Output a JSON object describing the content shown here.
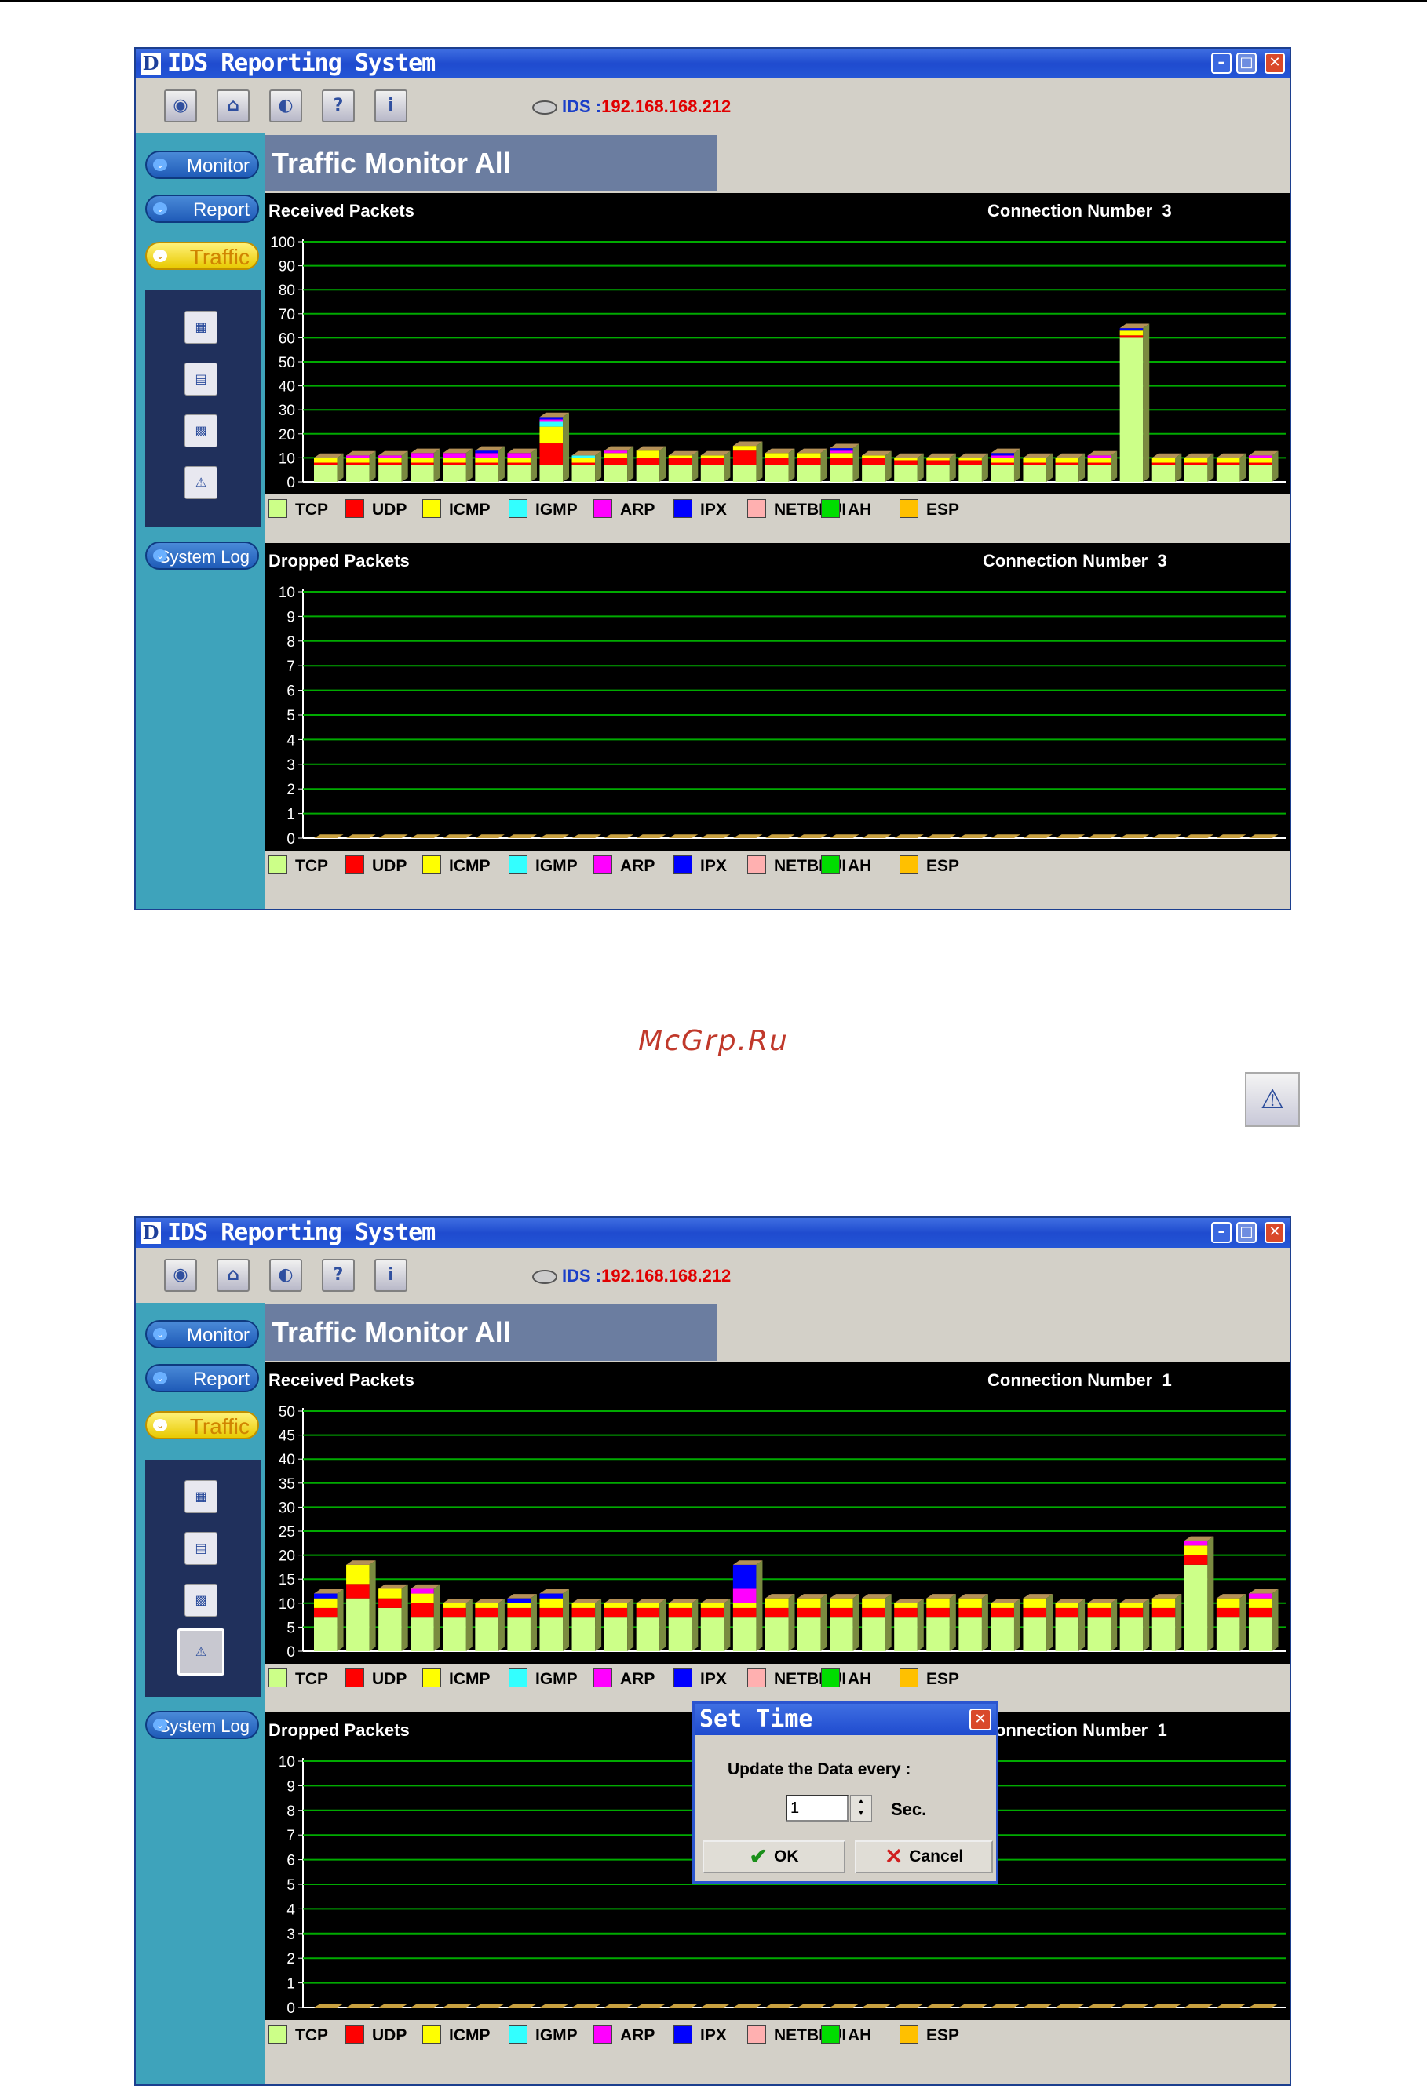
{
  "watermark": "McGrp.Ru",
  "standalone_icon": "traffic-cone-icon",
  "colors": {
    "TCP": "#ccff88",
    "UDP": "#ff0000",
    "ICMP": "#ffff00",
    "IGMP": "#33ffff",
    "ARP": "#ff00ff",
    "IPX": "#0000ff",
    "NETBEUI": "#ffb0b0",
    "AH": "#00dd00",
    "ESP": "#ffc000",
    "grid": "#00aa00"
  },
  "windows": [
    {
      "title": "IDS Reporting System",
      "logo": "D",
      "toolbar_icons": [
        "globe-icon",
        "tower-icon",
        "disk-icon",
        "help-icon",
        "info-icon"
      ],
      "ids_label": "IDS :",
      "ids_ip": "192.168.168.212",
      "nav": {
        "monitor": "Monitor",
        "report": "Report",
        "traffic": "Traffic",
        "system_log": "System Log"
      },
      "subicons": [
        "chart-1-icon",
        "chart-2-icon",
        "chart-3-icon",
        "cone-icon"
      ],
      "selected_subicon": -1,
      "header": "Traffic Monitor  All",
      "received": {
        "title": "Received Packets",
        "connection_label": "Connection Number",
        "connection_value": "3",
        "legend": [
          "TCP",
          "UDP",
          "ICMP",
          "IGMP",
          "ARP",
          "IPX",
          "NETBEUI",
          "AH",
          "ESP"
        ]
      },
      "dropped": {
        "title": "Dropped Packets",
        "connection_label": "Connection Number",
        "connection_value": "3",
        "legend": [
          "TCP",
          "UDP",
          "ICMP",
          "IGMP",
          "ARP",
          "IPX",
          "NETBEUI",
          "AH",
          "ESP"
        ]
      }
    },
    {
      "title": "IDS Reporting System",
      "logo": "D",
      "toolbar_icons": [
        "globe-icon",
        "tower-icon",
        "disk-icon",
        "help-icon",
        "info-icon"
      ],
      "ids_label": "IDS :",
      "ids_ip": "192.168.168.212",
      "nav": {
        "monitor": "Monitor",
        "report": "Report",
        "traffic": "Traffic",
        "system_log": "System Log"
      },
      "subicons": [
        "chart-1-icon",
        "chart-2-icon",
        "chart-3-icon",
        "cone-icon"
      ],
      "selected_subicon": 3,
      "header": "Traffic Monitor  All",
      "received": {
        "title": "Received Packets",
        "connection_label": "Connection Number",
        "connection_value": "1",
        "legend": [
          "TCP",
          "UDP",
          "ICMP",
          "IGMP",
          "ARP",
          "IPX",
          "NETBEUI",
          "AH",
          "ESP"
        ]
      },
      "dropped": {
        "title": "Dropped Packets",
        "connection_label": "Connection Number",
        "connection_value": "1",
        "legend": [
          "TCP",
          "UDP",
          "ICMP",
          "IGMP",
          "ARP",
          "IPX",
          "NETBEUI",
          "AH",
          "ESP"
        ]
      },
      "dialog": {
        "title": "Set Time",
        "label": "Update the Data every :",
        "value": "1",
        "unit": "Sec.",
        "ok": "OK",
        "cancel": "Cancel"
      }
    }
  ],
  "chart_data": [
    {
      "type": "bar",
      "stacked": true,
      "window": 1,
      "title": "Received Packets",
      "ylim": [
        0,
        100
      ],
      "yticks": [
        0,
        10,
        20,
        30,
        40,
        50,
        60,
        70,
        80,
        90,
        100
      ],
      "grid": true,
      "series_order": [
        "TCP",
        "UDP",
        "ICMP",
        "IGMP",
        "ARP",
        "IPX"
      ],
      "bars": [
        {
          "TCP": 7,
          "UDP": 1,
          "ICMP": 2
        },
        {
          "TCP": 7,
          "UDP": 1,
          "ICMP": 2,
          "ARP": 1
        },
        {
          "TCP": 7,
          "UDP": 1,
          "ICMP": 2,
          "ARP": 1
        },
        {
          "TCP": 7,
          "UDP": 1,
          "ICMP": 2,
          "ARP": 2
        },
        {
          "TCP": 7,
          "UDP": 1,
          "ICMP": 2,
          "ARP": 2
        },
        {
          "TCP": 7,
          "UDP": 1,
          "ICMP": 2,
          "ARP": 2,
          "IPX": 1
        },
        {
          "TCP": 7,
          "UDP": 1,
          "ICMP": 2,
          "ARP": 2
        },
        {
          "TCP": 7,
          "UDP": 9,
          "ICMP": 7,
          "IGMP": 2,
          "ARP": 1,
          "IPX": 1
        },
        {
          "TCP": 7,
          "UDP": 1,
          "ICMP": 2,
          "IGMP": 1
        },
        {
          "TCP": 7,
          "UDP": 3,
          "ICMP": 2,
          "ARP": 1
        },
        {
          "TCP": 7,
          "UDP": 3,
          "ICMP": 3
        },
        {
          "TCP": 7,
          "UDP": 3,
          "ICMP": 1
        },
        {
          "TCP": 7,
          "UDP": 3,
          "ICMP": 1
        },
        {
          "TCP": 7,
          "UDP": 6,
          "ICMP": 2
        },
        {
          "TCP": 7,
          "UDP": 3,
          "ICMP": 2
        },
        {
          "TCP": 7,
          "UDP": 3,
          "ICMP": 2
        },
        {
          "TCP": 7,
          "UDP": 3,
          "ICMP": 2,
          "ARP": 1,
          "IPX": 1
        },
        {
          "TCP": 7,
          "UDP": 3,
          "ICMP": 1
        },
        {
          "TCP": 7,
          "UDP": 2,
          "ICMP": 1
        },
        {
          "TCP": 7,
          "UDP": 2,
          "ICMP": 1
        },
        {
          "TCP": 7,
          "UDP": 2,
          "ICMP": 1
        },
        {
          "TCP": 7,
          "UDP": 1,
          "ICMP": 2,
          "ARP": 1,
          "IPX": 1
        },
        {
          "TCP": 7,
          "UDP": 1,
          "ICMP": 2
        },
        {
          "TCP": 7,
          "UDP": 1,
          "ICMP": 2
        },
        {
          "TCP": 7,
          "UDP": 1,
          "ICMP": 2,
          "ARP": 1
        },
        {
          "TCP": 60,
          "UDP": 1,
          "ICMP": 2,
          "IPX": 1
        },
        {
          "TCP": 7,
          "UDP": 1,
          "ICMP": 2
        },
        {
          "TCP": 7,
          "UDP": 1,
          "ICMP": 2
        },
        {
          "TCP": 7,
          "UDP": 1,
          "ICMP": 2
        },
        {
          "TCP": 7,
          "UDP": 1,
          "ICMP": 2,
          "ARP": 1
        }
      ]
    },
    {
      "type": "bar",
      "stacked": true,
      "window": 1,
      "title": "Dropped Packets",
      "ylim": [
        0,
        10
      ],
      "yticks": [
        0,
        1,
        2,
        3,
        4,
        5,
        6,
        7,
        8,
        9,
        10
      ],
      "grid": true,
      "bar_count": 30,
      "values": [
        0,
        0,
        0,
        0,
        0,
        0,
        0,
        0,
        0,
        0,
        0,
        0,
        0,
        0,
        0,
        0,
        0,
        0,
        0,
        0,
        0,
        0,
        0,
        0,
        0,
        0,
        0,
        0,
        0,
        0
      ]
    },
    {
      "type": "bar",
      "stacked": true,
      "window": 2,
      "title": "Received Packets",
      "ylim": [
        0,
        50
      ],
      "yticks": [
        0,
        5,
        10,
        15,
        20,
        25,
        30,
        35,
        40,
        45,
        50
      ],
      "grid": true,
      "series_order": [
        "TCP",
        "UDP",
        "ICMP",
        "IGMP",
        "ARP",
        "IPX"
      ],
      "bars": [
        {
          "TCP": 7,
          "UDP": 2,
          "ICMP": 2,
          "IPX": 1
        },
        {
          "TCP": 11,
          "UDP": 3,
          "ICMP": 4
        },
        {
          "TCP": 9,
          "UDP": 2,
          "ICMP": 2
        },
        {
          "TCP": 7,
          "UDP": 3,
          "ICMP": 2,
          "ARP": 1
        },
        {
          "TCP": 7,
          "UDP": 2,
          "ICMP": 1
        },
        {
          "TCP": 7,
          "UDP": 2,
          "ICMP": 1
        },
        {
          "TCP": 7,
          "UDP": 2,
          "ICMP": 1,
          "IPX": 1
        },
        {
          "TCP": 7,
          "UDP": 2,
          "ICMP": 2,
          "IPX": 1
        },
        {
          "TCP": 7,
          "UDP": 2,
          "ICMP": 1
        },
        {
          "TCP": 7,
          "UDP": 2,
          "ICMP": 1
        },
        {
          "TCP": 7,
          "UDP": 2,
          "ICMP": 1
        },
        {
          "TCP": 7,
          "UDP": 2,
          "ICMP": 1
        },
        {
          "TCP": 7,
          "UDP": 2,
          "ICMP": 1
        },
        {
          "TCP": 7,
          "UDP": 2,
          "ICMP": 1,
          "ARP": 3,
          "IPX": 5
        },
        {
          "TCP": 7,
          "UDP": 2,
          "ICMP": 2
        },
        {
          "TCP": 7,
          "UDP": 2,
          "ICMP": 2
        },
        {
          "TCP": 7,
          "UDP": 2,
          "ICMP": 2
        },
        {
          "TCP": 7,
          "UDP": 2,
          "ICMP": 2
        },
        {
          "TCP": 7,
          "UDP": 2,
          "ICMP": 1
        },
        {
          "TCP": 7,
          "UDP": 2,
          "ICMP": 2
        },
        {
          "TCP": 7,
          "UDP": 2,
          "ICMP": 2
        },
        {
          "TCP": 7,
          "UDP": 2,
          "ICMP": 1
        },
        {
          "TCP": 7,
          "UDP": 2,
          "ICMP": 2
        },
        {
          "TCP": 7,
          "UDP": 2,
          "ICMP": 1
        },
        {
          "TCP": 7,
          "UDP": 2,
          "ICMP": 1
        },
        {
          "TCP": 7,
          "UDP": 2,
          "ICMP": 1
        },
        {
          "TCP": 7,
          "UDP": 2,
          "ICMP": 2
        },
        {
          "TCP": 18,
          "UDP": 2,
          "ICMP": 2,
          "ARP": 1
        },
        {
          "TCP": 7,
          "UDP": 2,
          "ICMP": 2
        },
        {
          "TCP": 7,
          "UDP": 2,
          "ICMP": 2,
          "ARP": 1
        }
      ]
    },
    {
      "type": "bar",
      "stacked": true,
      "window": 2,
      "title": "Dropped Packets",
      "ylim": [
        0,
        10
      ],
      "yticks": [
        0,
        1,
        2,
        3,
        4,
        5,
        6,
        7,
        8,
        9,
        10
      ],
      "grid": true,
      "bar_count": 30,
      "values": [
        0,
        0,
        0,
        0,
        0,
        0,
        0,
        0,
        0,
        0,
        0,
        0,
        0,
        0,
        0,
        0,
        0,
        0,
        0,
        0,
        0,
        0,
        0,
        0,
        0,
        0,
        0,
        0,
        0,
        0
      ]
    }
  ]
}
